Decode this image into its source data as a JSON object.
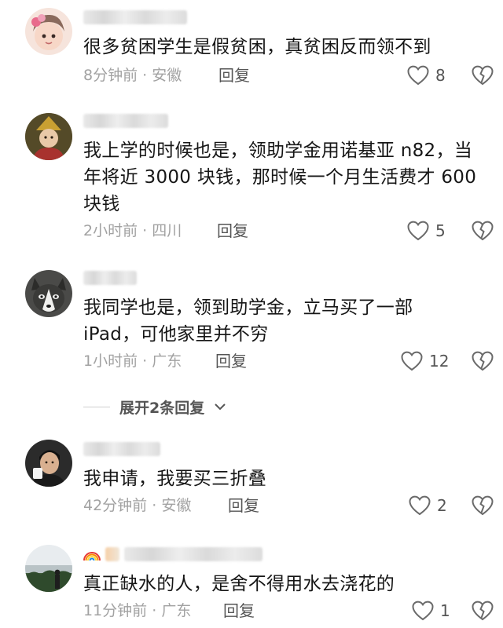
{
  "comments": [
    {
      "text": "很多贫困学生是假贫困，真贫困反而领不到",
      "time": "8分钟前",
      "location": "安徽",
      "reply_label": "回复",
      "likes": "8",
      "avatar_icon": "child-avatar"
    },
    {
      "text": "我上学的时候也是，领助学金用诺基亚 n82，当年将近 3000 块钱，那时候一个月生活费才 600 块钱",
      "time": "2小时前",
      "location": "四川",
      "reply_label": "回复",
      "likes": "5",
      "avatar_icon": "costume-avatar"
    },
    {
      "text": "我同学也是，领到助学金，立马买了一部 iPad，可他家里并不穷",
      "time": "1小时前",
      "location": "广东",
      "reply_label": "回复",
      "likes": "12",
      "avatar_icon": "husky-avatar"
    },
    {
      "text": "我申请，我要买三折叠",
      "time": "42分钟前",
      "location": "安徽",
      "reply_label": "回复",
      "likes": "2",
      "avatar_icon": "man-with-cup-avatar"
    },
    {
      "text": "真正缺水的人，是舍不得用水去浇花的",
      "time": "11分钟前",
      "location": "广东",
      "reply_label": "回复",
      "likes": "1",
      "avatar_icon": "sunset-avatar"
    }
  ],
  "expand_replies": {
    "label": "展开2条回复"
  },
  "meta_separator": " · ",
  "colors": {
    "text": "#161616",
    "meta": "#a2a2a2",
    "action": "#555555",
    "rainbow_badge": [
      "#e53935",
      "#fb8c00",
      "#fdd835",
      "#43a047",
      "#1e88e5",
      "#8e24aa"
    ]
  }
}
